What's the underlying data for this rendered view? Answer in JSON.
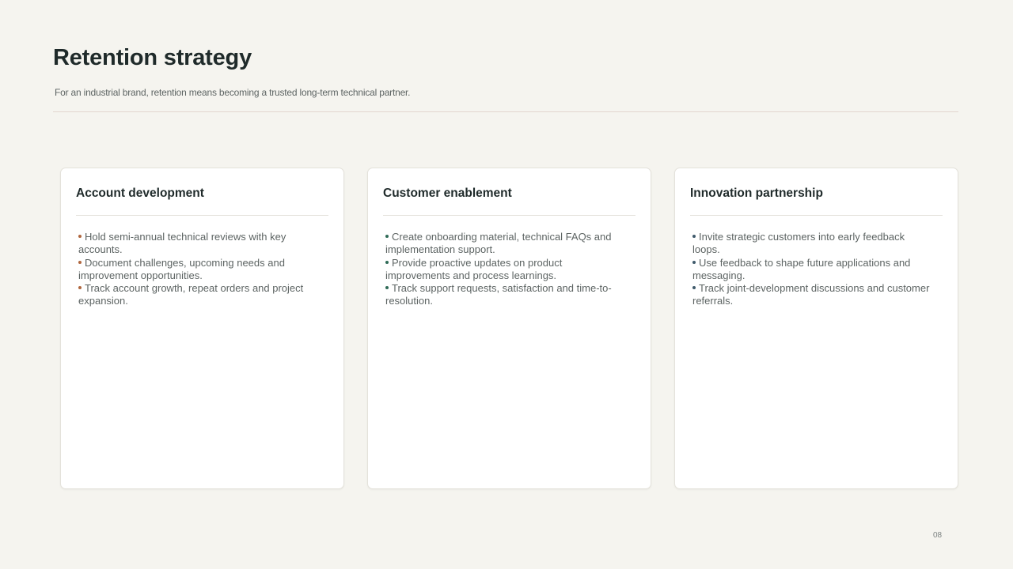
{
  "slide": {
    "title": "Retention strategy",
    "subtitle": "For an industrial brand, retention means becoming a trusted long-term technical partner.",
    "page_number": "08"
  },
  "cards": [
    {
      "title": "Account development",
      "bullet_color": "#b0673f",
      "bullets": [
        "Hold semi-annual technical reviews with key accounts.",
        "Document challenges, upcoming needs and improvement opportunities.",
        "Track account growth, repeat orders and project expansion."
      ]
    },
    {
      "title": "Customer enablement",
      "bullet_color": "#2f6b57",
      "bullets": [
        "Create onboarding material, technical FAQs and implementation support.",
        "Provide proactive updates on product improvements and process learnings.",
        "Track support requests, satisfaction and time-to-resolution."
      ]
    },
    {
      "title": "Innovation partnership",
      "bullet_color": "#3f5a6b",
      "bullets": [
        "Invite strategic customers into early feedback loops.",
        "Use feedback to shape future applications and messaging.",
        "Track joint-development discussions and customer referrals."
      ]
    }
  ]
}
